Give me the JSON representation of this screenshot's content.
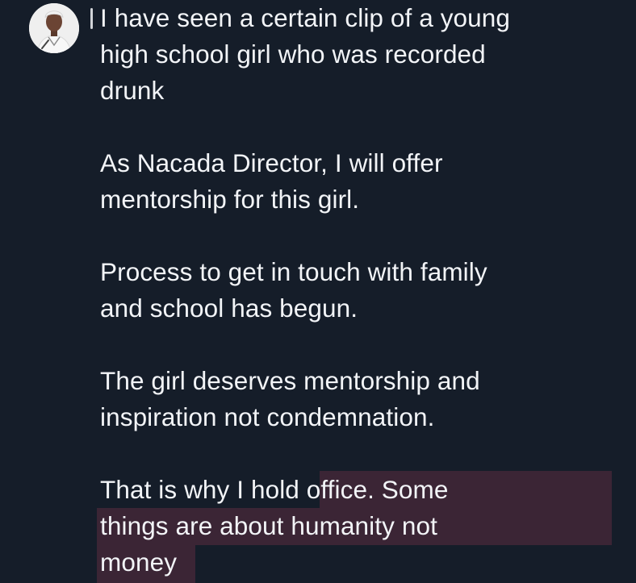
{
  "tweet": {
    "author_avatar": "profile-photo",
    "paragraphs": [
      "I have seen a certain clip of a young\nhigh school girl who was recorded\ndrunk",
      "As Nacada Director, I will offer\nmentorship for this girl.",
      "Process to get in touch with family\nand school has begun.",
      "The girl deserves mentorship and\ninspiration not condemnation.",
      "That is why I hold office. Some\nthings are about humanity not\nmoney"
    ]
  },
  "colors": {
    "background": "#151d29",
    "text": "#f2f4f7",
    "highlight": "#3b2535"
  }
}
